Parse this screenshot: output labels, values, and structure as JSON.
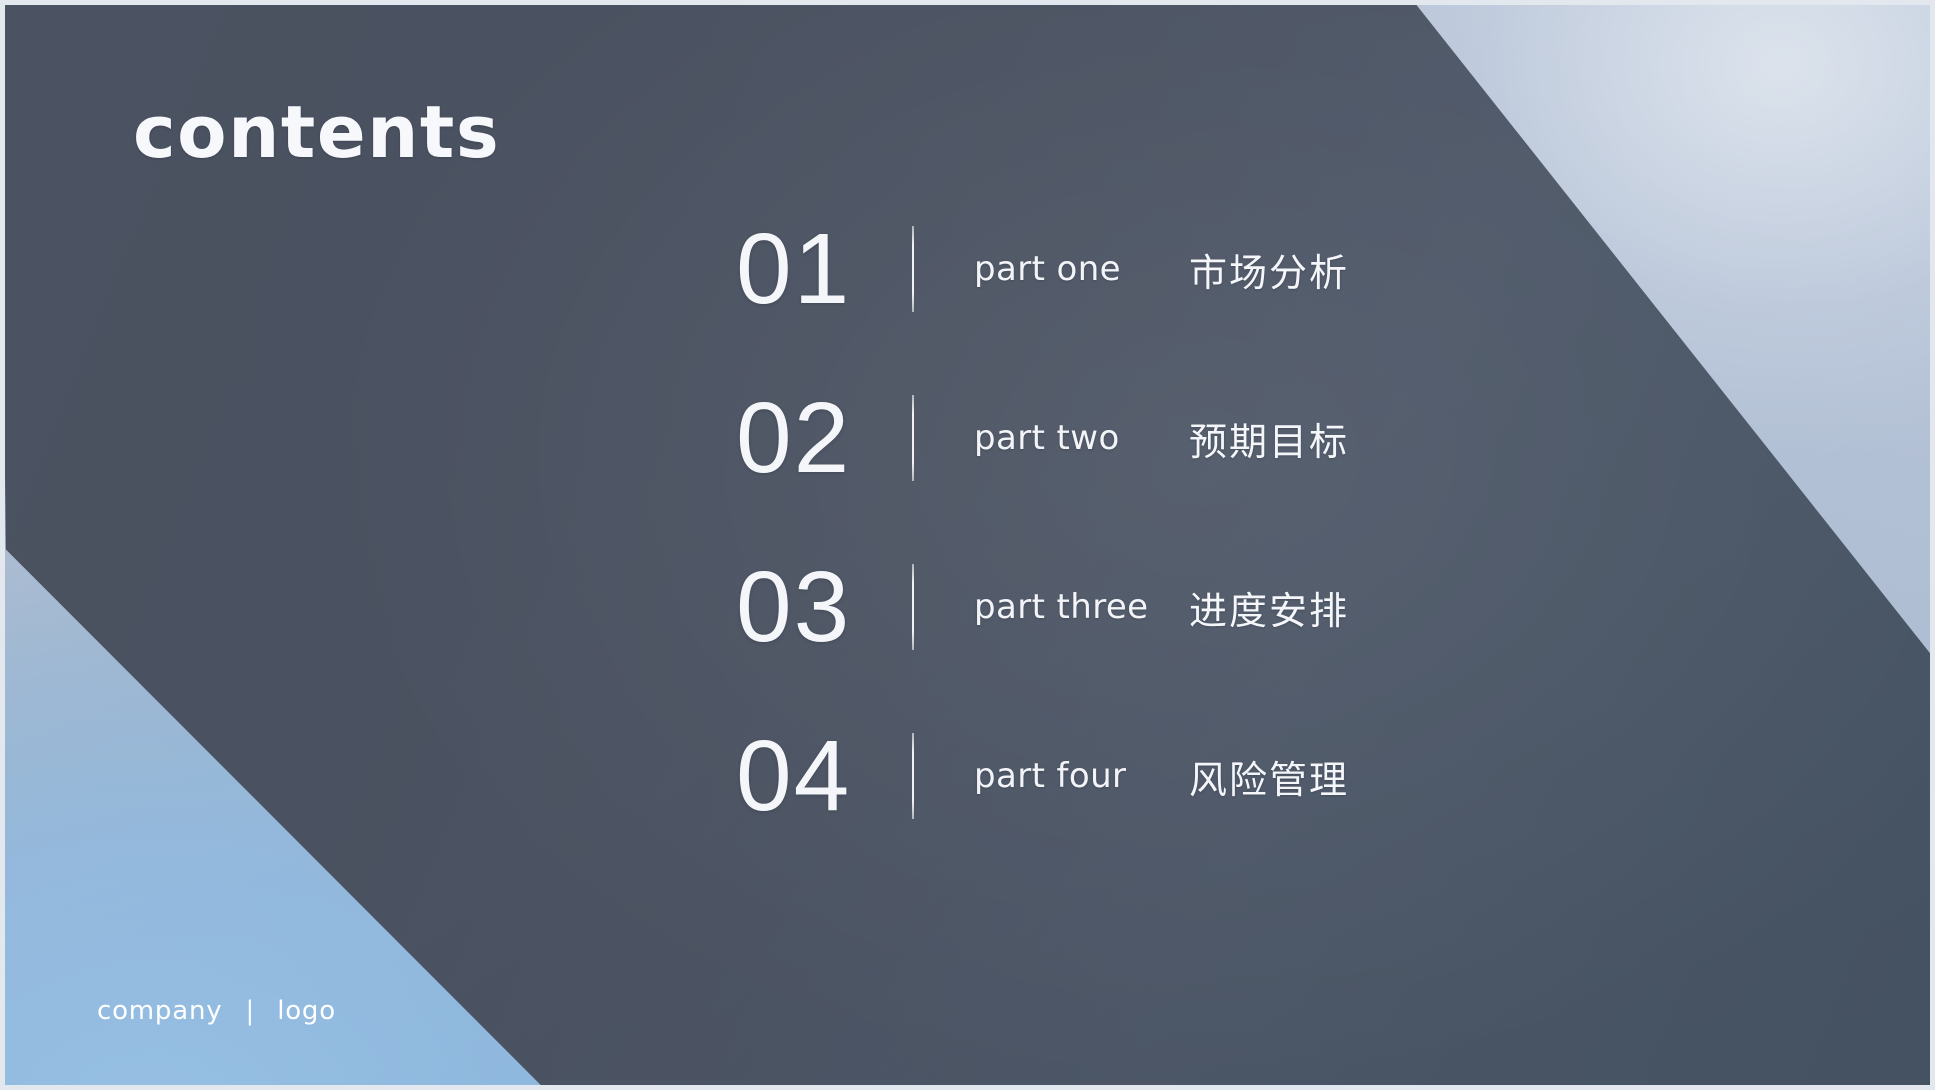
{
  "slide": {
    "title": "contents",
    "items": [
      {
        "number": "01",
        "english": "part one",
        "chinese": "市场分析"
      },
      {
        "number": "02",
        "english": "part two",
        "chinese": "预期目标"
      },
      {
        "number": "03",
        "english": "part three",
        "chinese": "进度安排"
      },
      {
        "number": "04",
        "english": "part four",
        "chinese": "风险管理"
      }
    ],
    "footer": {
      "company": "company",
      "separator": "|",
      "logo": "logo"
    },
    "colors": {
      "dark_panel": "#4b5261",
      "light_blue": "#8ab3d8",
      "pale_blue": "#bcc8da",
      "text_white": "#f4f6fa"
    }
  }
}
